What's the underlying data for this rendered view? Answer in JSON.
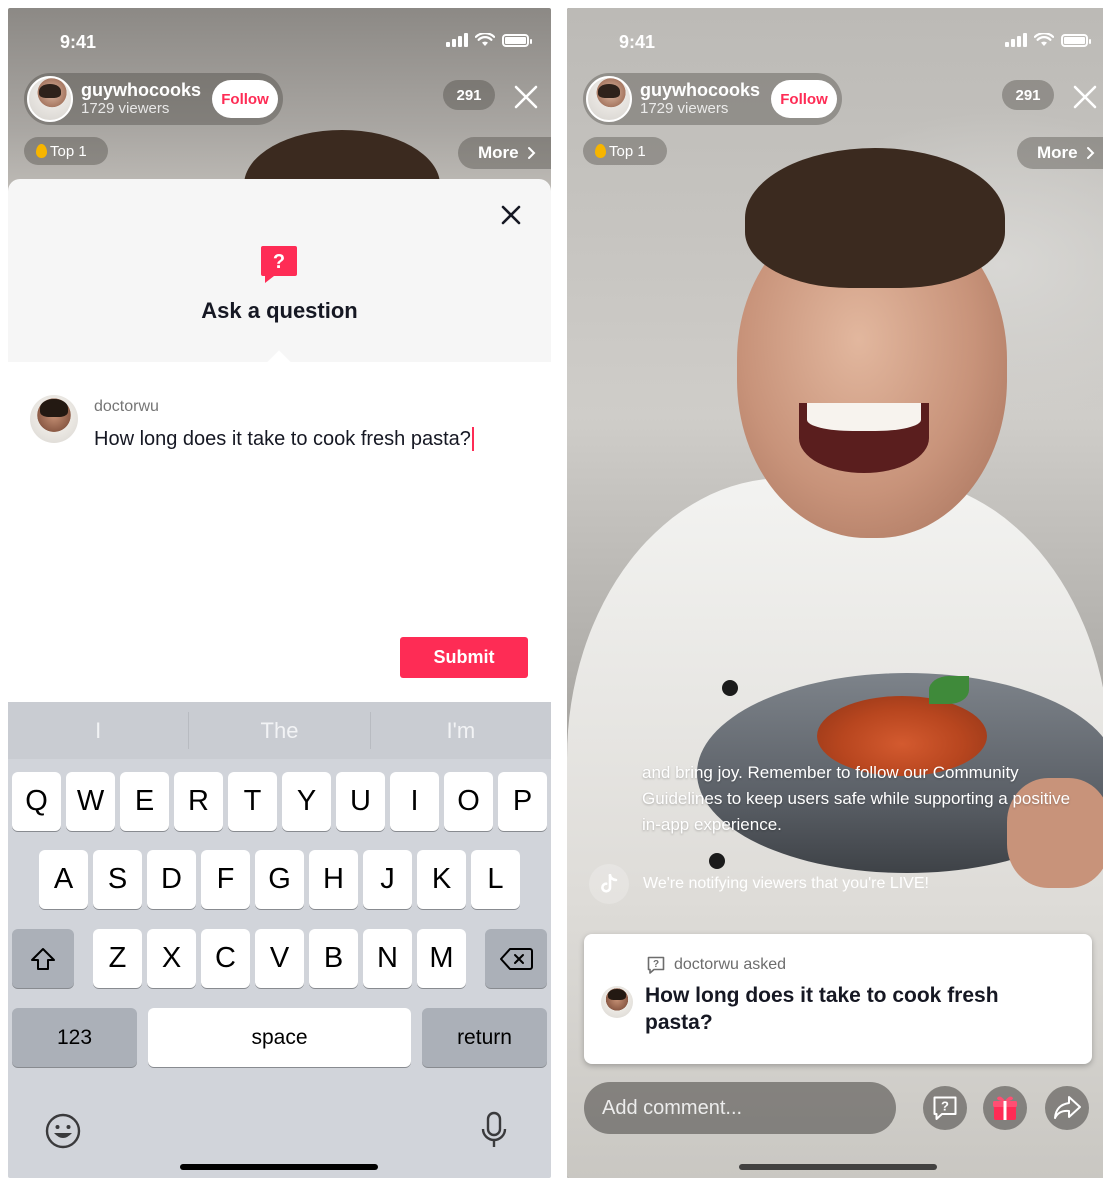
{
  "status_bar": {
    "time": "9:41"
  },
  "live_header": {
    "host_name": "guywhocooks",
    "viewers": "1729 viewers",
    "follow_label": "Follow",
    "viewer_count": "291",
    "top_badge": "Top 1",
    "more_label": "More"
  },
  "ask_sheet": {
    "title": "Ask a question",
    "question_icon_glyph": "?",
    "asker_name": "doctorwu",
    "question_text": "How long does it take to cook fresh pasta?",
    "submit_label": "Submit"
  },
  "keyboard": {
    "suggestions": [
      "I",
      "The",
      "I'm"
    ],
    "row1": [
      "Q",
      "W",
      "E",
      "R",
      "T",
      "Y",
      "U",
      "I",
      "O",
      "P"
    ],
    "row2": [
      "A",
      "S",
      "D",
      "F",
      "G",
      "H",
      "J",
      "K",
      "L"
    ],
    "row3": [
      "Z",
      "X",
      "C",
      "V",
      "B",
      "N",
      "M"
    ],
    "numbers_label": "123",
    "space_label": "space",
    "return_label": "return"
  },
  "live_screen": {
    "guideline_text": "and bring joy. Remember to follow our Community Guidelines to keep users safe while supporting a positive in-app experience.",
    "notify_text": "We're notifying viewers that you're LIVE!",
    "question_card": {
      "meta": "doctorwu asked",
      "question": "How long does it take to cook fresh pasta?"
    },
    "comment_placeholder": "Add comment..."
  },
  "colors": {
    "accent": "#fe2c55",
    "keyboard_bg": "#d1d4da",
    "sheet_header_bg": "#f6f6f6"
  },
  "icons": [
    "signal-icon",
    "wifi-icon",
    "battery-icon",
    "close-icon",
    "chevron-right-icon",
    "flame-icon",
    "question-bubble-icon",
    "shift-icon",
    "backspace-icon",
    "emoji-icon",
    "microphone-icon",
    "tiktok-logo-icon",
    "gift-icon",
    "share-icon"
  ]
}
